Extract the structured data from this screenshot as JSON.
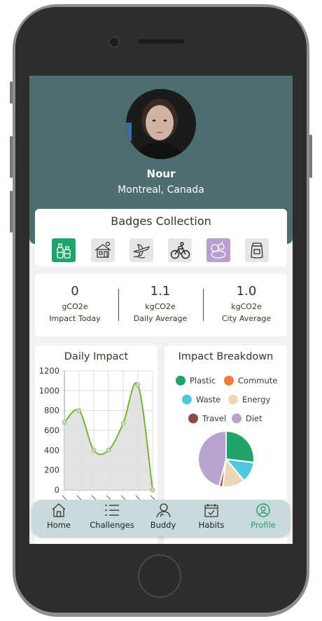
{
  "profile": {
    "name": "Nour",
    "location": "Montreal, Canada"
  },
  "badges": {
    "title": "Badges Collection",
    "items": [
      {
        "icon": "bottles-icon",
        "active": true,
        "color": "#21a46c"
      },
      {
        "icon": "house-icon",
        "active": false,
        "color": "#e6e6e6"
      },
      {
        "icon": "airplane-icon",
        "active": false,
        "color": "#e6e6e6"
      },
      {
        "icon": "cyclist-icon",
        "active": false,
        "color": "#e6e6e6"
      },
      {
        "icon": "fruit-icon",
        "active": true,
        "color": "#b89fcf"
      },
      {
        "icon": "jar-icon",
        "active": false,
        "color": "#e6e6e6"
      }
    ]
  },
  "stats": [
    {
      "value": "0",
      "unit": "gCO2e",
      "label": "Impact Today"
    },
    {
      "value": "1.1",
      "unit": "kgCO2e",
      "label": "Daily Average"
    },
    {
      "value": "1.0",
      "unit": "kgCO2e",
      "label": "City Average"
    }
  ],
  "daily_impact": {
    "title": "Daily Impact"
  },
  "breakdown": {
    "title": "Impact Breakdown",
    "legend": [
      {
        "label": "Plastic",
        "color": "#21a46c"
      },
      {
        "label": "Commute",
        "color": "#f47b3b"
      },
      {
        "label": "Waste",
        "color": "#4fc8e0"
      },
      {
        "label": "Energy",
        "color": "#ecd6b6"
      },
      {
        "label": "Travel",
        "color": "#8b4a46"
      },
      {
        "label": "Diet",
        "color": "#b8a2cf"
      }
    ]
  },
  "chart_data": [
    {
      "type": "line",
      "title": "Daily Impact",
      "ylim": [
        0,
        1200
      ],
      "yticks": [
        0,
        200,
        400,
        600,
        800,
        1000,
        1200
      ],
      "x": [
        1,
        2,
        3,
        4,
        5,
        6,
        7
      ],
      "values": [
        680,
        800,
        400,
        400,
        670,
        1060,
        0
      ],
      "grid": true,
      "fill_color": "#e0e0e0",
      "line_color": "#78b42e"
    },
    {
      "type": "pie",
      "title": "Impact Breakdown",
      "labels": [
        "Plastic",
        "Waste",
        "Energy",
        "Travel",
        "Diet"
      ],
      "values": [
        27,
        12,
        13,
        2,
        46
      ],
      "colors": [
        "#21a46c",
        "#4fc8e0",
        "#ecd6b6",
        "#8b4a46",
        "#b8a2cf"
      ]
    }
  ],
  "nav": [
    {
      "label": "Home",
      "icon": "home-icon",
      "active": false
    },
    {
      "label": "Challenges",
      "icon": "list-icon",
      "active": false
    },
    {
      "label": "Buddy",
      "icon": "buddy-icon",
      "active": false
    },
    {
      "label": "Habits",
      "icon": "calendar-check-icon",
      "active": false
    },
    {
      "label": "Profile",
      "icon": "profile-icon",
      "active": true
    }
  ],
  "colors": {
    "hero": "#4e6d6e",
    "accent": "#2f9b6a",
    "tabbar": "#c8dadb"
  }
}
